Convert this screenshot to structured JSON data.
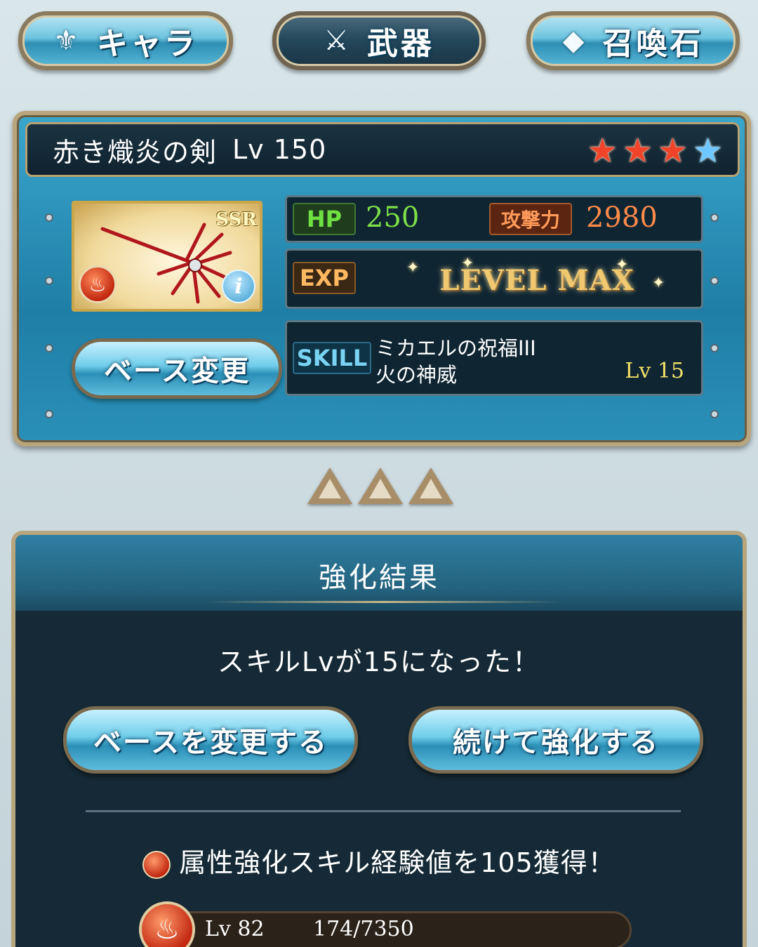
{
  "tabs": {
    "chara": {
      "label": "キャラ",
      "icon": "chara-icon"
    },
    "weapon": {
      "label": "武器",
      "icon": "weapon-icon"
    },
    "summon": {
      "label": "召喚石",
      "icon": "summon-stone-icon"
    }
  },
  "weapon": {
    "name": "赤き熾炎の剣",
    "level": "Lv 150",
    "rarity": "SSR",
    "stars_filled": 3,
    "stars_total": 4,
    "hp_label": "HP",
    "hp": "250",
    "atk_label": "攻撃力",
    "atk": "2980",
    "exp_label": "EXP",
    "exp_status": "LEVEL MAX",
    "skill_label": "SKILL",
    "skill_name_1": "ミカエルの祝福III",
    "skill_name_2": "火の神威",
    "skill_level": "Lv  15",
    "element": "fire",
    "info_glyph": "i"
  },
  "base_button": "ベース変更",
  "result": {
    "title": "強化結果",
    "message": "スキルLvが15になった！",
    "change_base_button": "ベースを変更する",
    "continue_button": "続けて強化する",
    "element_message": "属性強化スキル経験値を105獲得！",
    "exp_level": "Lv 82",
    "exp_progress": "174/7350",
    "exp_fraction": 0.0237
  },
  "colors": {
    "accent_blue": "#2b8fb7",
    "hp_green": "#7ee047",
    "atk_orange": "#ff8a4a",
    "skill_lv_yellow": "#f4e36a",
    "frame_gold": "#b9a57c"
  }
}
